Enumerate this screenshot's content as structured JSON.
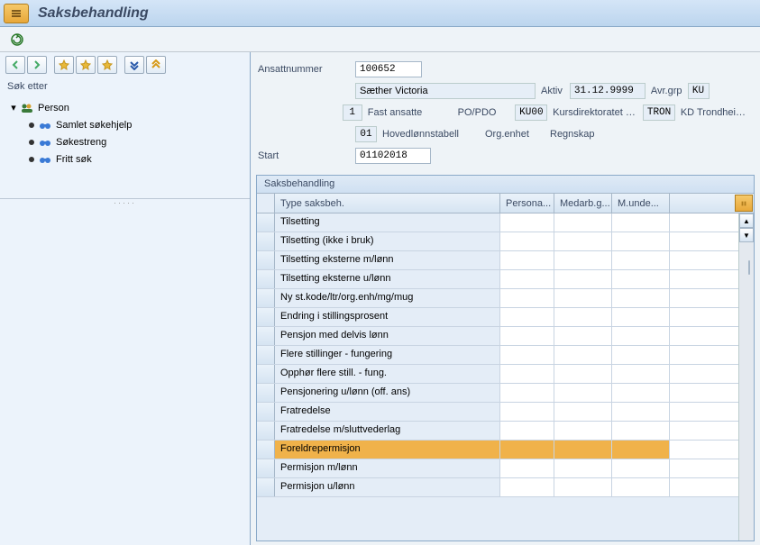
{
  "title": "Saksbehandling",
  "left": {
    "search_label": "Søk etter",
    "root": "Person",
    "children": [
      "Samlet søkehjelp",
      "Søkestreng",
      "Fritt søk"
    ]
  },
  "form": {
    "ansatt_label": "Ansattnummer",
    "ansatt_value": "100652",
    "name": "Sæther Victoria",
    "aktiv": "Aktiv",
    "date1": "31.12.9999",
    "avrgrp_label": "Avr.grp",
    "avrgrp_code": "KU",
    "row2_code": "1",
    "row2_text": "Fast ansatte",
    "popdo": "PO/PDO",
    "ku00": "KU00",
    "kursdir": "Kursdirektoratet …",
    "tron": "TRON",
    "kdtrond": "KD Trondhei…",
    "row3_code": "01",
    "row3_text": "Hovedlønnstabell",
    "orgenhet": "Org.enhet",
    "regnskap": "Regnskap",
    "start_label": "Start",
    "start_value": "01102018"
  },
  "grid": {
    "title": "Saksbehandling",
    "headers": {
      "c1": "Type saksbeh.",
      "c2": "Persona...",
      "c3": "Medarb.g...",
      "c4": "M.unde..."
    },
    "rows": [
      {
        "c1": "Tilsetting"
      },
      {
        "c1": "Tilsetting (ikke i bruk)"
      },
      {
        "c1": "Tilsetting eksterne m/lønn"
      },
      {
        "c1": "Tilsetting eksterne u/lønn"
      },
      {
        "c1": "Ny st.kode/ltr/org.enh/mg/mug"
      },
      {
        "c1": "Endring i stillingsprosent"
      },
      {
        "c1": "Pensjon med delvis lønn"
      },
      {
        "c1": "Flere stillinger - fungering"
      },
      {
        "c1": "Opphør flere still. - fung."
      },
      {
        "c1": "Pensjonering u/lønn (off. ans)"
      },
      {
        "c1": "Fratredelse"
      },
      {
        "c1": "Fratredelse m/sluttvederlag"
      },
      {
        "c1": "Foreldrepermisjon",
        "selected": true
      },
      {
        "c1": "Permisjon m/lønn"
      },
      {
        "c1": "Permisjon u/lønn"
      }
    ]
  }
}
